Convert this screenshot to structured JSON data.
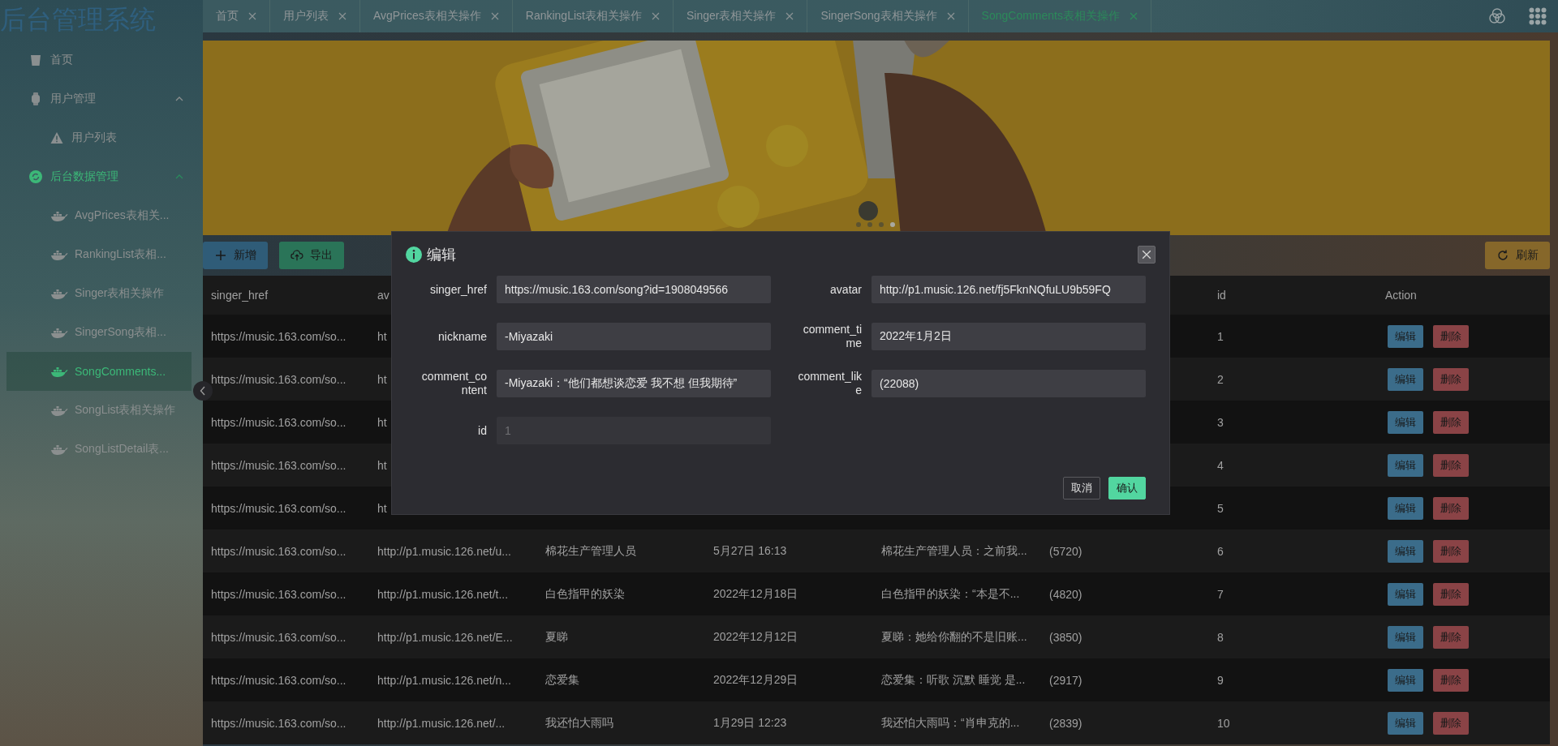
{
  "app_title": "后台管理系统",
  "sidebar": {
    "items": [
      {
        "label": "首页",
        "selected": false
      },
      {
        "label": "用户管理",
        "selected": false,
        "expanded": true,
        "children": [
          {
            "label": "用户列表",
            "selected": false
          }
        ]
      },
      {
        "label": "后台数据管理",
        "selected": true,
        "expanded": true,
        "children": [
          {
            "label": "AvgPrices表相关...",
            "selected": false
          },
          {
            "label": "RankingList表相...",
            "selected": false
          },
          {
            "label": "Singer表相关操作",
            "selected": false
          },
          {
            "label": "SingerSong表相...",
            "selected": false
          },
          {
            "label": "SongComments...",
            "selected": true
          },
          {
            "label": "SongList表相关操作",
            "selected": false
          },
          {
            "label": "SongListDetail表...",
            "selected": false
          }
        ]
      }
    ]
  },
  "tabs": [
    {
      "label": "首页",
      "selected": false
    },
    {
      "label": "用户列表",
      "selected": false
    },
    {
      "label": "AvgPrices表相关操作",
      "selected": false
    },
    {
      "label": "RankingList表相关操作",
      "selected": false
    },
    {
      "label": "Singer表相关操作",
      "selected": false
    },
    {
      "label": "SingerSong表相关操作",
      "selected": false
    },
    {
      "label": "SongComments表相关操作",
      "selected": true
    }
  ],
  "carousel": {
    "dots": [
      {
        "selected": false
      },
      {
        "selected": false
      },
      {
        "selected": false
      },
      {
        "selected": true
      }
    ]
  },
  "toolbar": {
    "add": "新增",
    "export": "导出",
    "refresh": "刷新"
  },
  "table": {
    "header": {
      "singer_href": "singer_href",
      "avatar": "av",
      "id": "id",
      "action": "Action"
    },
    "rows": [
      {
        "singer_href": "https://music.163.com/so...",
        "avatar": "ht",
        "id": "1",
        "actions": [
          "编辑",
          "删除"
        ]
      },
      {
        "singer_href": "https://music.163.com/so...",
        "avatar": "ht",
        "id": "2",
        "actions": [
          "编辑",
          "删除"
        ]
      },
      {
        "singer_href": "https://music.163.com/so...",
        "avatar": "ht",
        "id": "3",
        "actions": [
          "编辑",
          "删除"
        ]
      },
      {
        "singer_href": "https://music.163.com/so...",
        "avatar": "ht",
        "id": "4",
        "actions": [
          "编辑",
          "删除"
        ]
      },
      {
        "singer_href": "https://music.163.com/so...",
        "avatar": "ht",
        "id": "5",
        "actions": [
          "编辑",
          "删除"
        ]
      },
      {
        "singer_href": "https://music.163.com/so...",
        "avatar": "http://p1.music.126.net/u...",
        "nickname": "棉花生产管理人员",
        "comment_time": "5月27日 16:13",
        "comment_content": "棉花生产管理人员：之前我...",
        "comment_like": "(5720)",
        "id": "6",
        "actions": [
          "编辑",
          "删除"
        ]
      },
      {
        "singer_href": "https://music.163.com/so...",
        "avatar": "http://p1.music.126.net/t...",
        "nickname": "白色指甲的妖染",
        "comment_time": "2022年12月18日",
        "comment_content": "白色指甲的妖染：“本是不...",
        "comment_like": "(4820)",
        "id": "7",
        "actions": [
          "编辑",
          "删除"
        ]
      },
      {
        "singer_href": "https://music.163.com/so...",
        "avatar": "http://p1.music.126.net/E...",
        "nickname": "夏睇",
        "comment_time": "2022年12月12日",
        "comment_content": "夏睇：她给你翻的不是旧账...",
        "comment_like": "(3850)",
        "id": "8",
        "actions": [
          "编辑",
          "删除"
        ]
      },
      {
        "singer_href": "https://music.163.com/so...",
        "avatar": "http://p1.music.126.net/n...",
        "nickname": "恋爱集",
        "comment_time": "2022年12月29日",
        "comment_content": "恋爱集：听歌 沉默 睡觉 是...",
        "comment_like": "(2917)",
        "id": "9",
        "actions": [
          "编辑",
          "删除"
        ]
      },
      {
        "singer_href": "https://music.163.com/so...",
        "avatar": "http://p1.music.126.net/...",
        "nickname": "我还怕大雨吗",
        "comment_time": "1月29日 12:23",
        "comment_content": "我还怕大雨吗：“肖申克的...",
        "comment_like": "(2839)",
        "id": "10",
        "actions": [
          "编辑",
          "删除"
        ]
      }
    ]
  },
  "dialog": {
    "title": "编辑",
    "fields": [
      {
        "label": "singer_href",
        "value": "https://music.163.com/song?id=1908049566",
        "disabled": false
      },
      {
        "label": "avatar",
        "value": "http://p1.music.126.net/fj5FknNQfuLU9b59FQ",
        "disabled": false
      },
      {
        "label": "nickname",
        "value": "-Miyazaki",
        "disabled": false
      },
      {
        "label": "comment_time",
        "value": "2022年1月2日",
        "disabled": false
      },
      {
        "label": "comment_content",
        "value": "-Miyazaki：“他们都想谈恋爱 我不想 但我期待”",
        "disabled": false
      },
      {
        "label": "comment_like",
        "value": "(22088)",
        "disabled": false
      },
      {
        "label": "id",
        "value": "1",
        "disabled": true
      }
    ],
    "cancel": "取消",
    "confirm": "确认"
  }
}
